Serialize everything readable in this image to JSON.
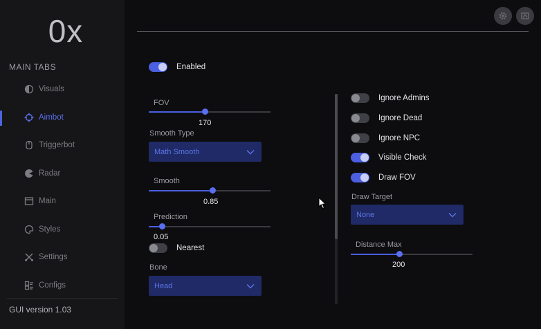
{
  "sidebar": {
    "logo": "0x",
    "section_label": "MAIN TABS",
    "items": [
      {
        "label": "Visuals",
        "icon": "visuals-icon",
        "active": false
      },
      {
        "label": "Aimbot",
        "icon": "crosshair-icon",
        "active": true
      },
      {
        "label": "Triggerbot",
        "icon": "triggerbot-icon",
        "active": false
      },
      {
        "label": "Radar",
        "icon": "radar-icon",
        "active": false
      },
      {
        "label": "Main",
        "icon": "main-icon",
        "active": false
      },
      {
        "label": "Styles",
        "icon": "palette-icon",
        "active": false
      },
      {
        "label": "Settings",
        "icon": "settings-icon",
        "active": false
      },
      {
        "label": "Configs",
        "icon": "configs-icon",
        "active": false
      }
    ],
    "version": "GUI version 1.03"
  },
  "header": {
    "buttons": [
      "gear-icon",
      "flag-icon"
    ]
  },
  "left": {
    "enabled": {
      "label": "Enabled",
      "on": true
    },
    "fov": {
      "label": "FOV",
      "value": "170",
      "fraction": 0.46
    },
    "smooth_type": {
      "label": "Smooth Type",
      "selected": "Math Smooth"
    },
    "smooth": {
      "label": "Smooth",
      "value": "0.85",
      "fraction": 0.52
    },
    "prediction": {
      "label": "Prediction",
      "value": "0.05",
      "fraction": 0.11
    },
    "nearest": {
      "label": "Nearest",
      "on": false
    },
    "bone": {
      "label": "Bone",
      "selected": "Head"
    }
  },
  "right": {
    "toggles": [
      {
        "label": "Ignore Admins",
        "on": false
      },
      {
        "label": "Ignore Dead",
        "on": false
      },
      {
        "label": "Ignore NPC",
        "on": false
      },
      {
        "label": "Visible Check",
        "on": true
      },
      {
        "label": "Draw FOV",
        "on": true
      }
    ],
    "draw_target": {
      "label": "Draw Target",
      "selected": "None"
    },
    "distance_max": {
      "label": "Distance Max",
      "value": "200",
      "fraction": 0.4
    }
  },
  "colors": {
    "accent": "#4b5fe0",
    "dropdown_bg": "#1f2a66",
    "sidebar_bg": "#161618",
    "bg": "#0d0d0f"
  }
}
